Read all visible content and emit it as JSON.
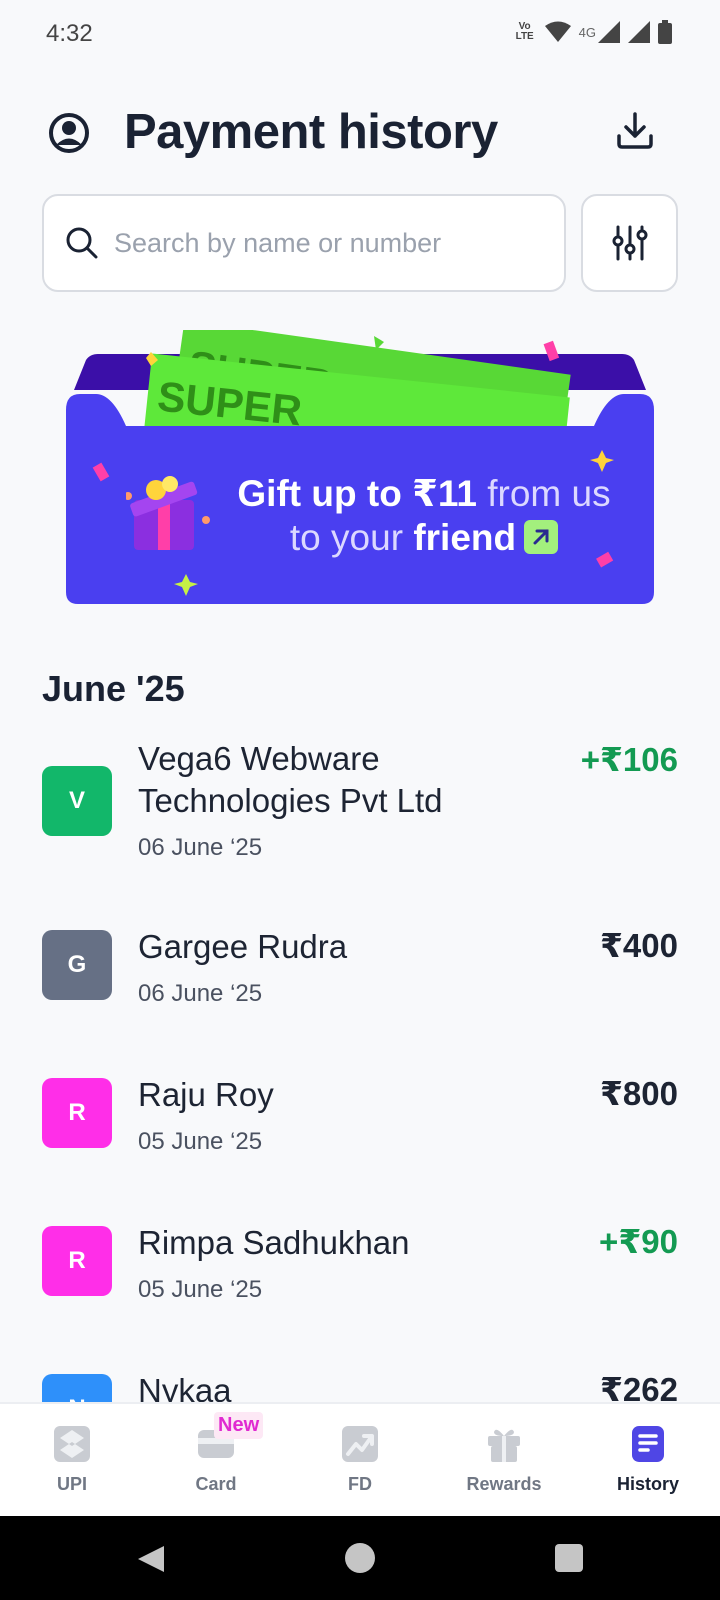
{
  "status_bar": {
    "time": "4:32",
    "volte_line1": "Vo",
    "volte_line2": "LTE",
    "network": "4G"
  },
  "header": {
    "title": "Payment history",
    "profile_icon": "profile-icon",
    "download_icon": "download-icon"
  },
  "search": {
    "placeholder": "Search by name or number",
    "value": ""
  },
  "promo": {
    "line1_bold": "Gift up to ₹11",
    "line1_light": " from us",
    "line2_light": "to your ",
    "line2_bold": "friend",
    "ticket_text": "SUPER"
  },
  "section": {
    "month": "June '25"
  },
  "transactions": [
    {
      "initial": "V",
      "name": "Vega6 Webware Technologies Pvt Ltd",
      "date": "06 June ‘25",
      "amount": "+₹106",
      "type": "credit",
      "avatar_color": "#12b76a"
    },
    {
      "initial": "G",
      "name": "Gargee  Rudra",
      "date": "06 June ‘25",
      "amount": "₹400",
      "type": "debit",
      "avatar_color": "#667085"
    },
    {
      "initial": "R",
      "name": "Raju Roy",
      "date": "05 June ‘25",
      "amount": "₹800",
      "type": "debit",
      "avatar_color": "#ff2ee8"
    },
    {
      "initial": "R",
      "name": "Rimpa  Sadhukhan",
      "date": "05 June ‘25",
      "amount": "+₹90",
      "type": "credit",
      "avatar_color": "#ff2ee8"
    },
    {
      "initial": "N",
      "name": "Nykaa",
      "date": "",
      "amount": "₹262",
      "type": "debit",
      "avatar_color": "#2e90fa"
    }
  ],
  "bottom_nav": {
    "items": [
      {
        "label": "UPI",
        "icon": "upi-icon"
      },
      {
        "label": "Card",
        "icon": "card-icon",
        "badge": "New"
      },
      {
        "label": "FD",
        "icon": "fd-chart-icon"
      },
      {
        "label": "Rewards",
        "icon": "gift-icon"
      },
      {
        "label": "History",
        "icon": "history-icon",
        "active": true
      }
    ]
  },
  "colors": {
    "accent": "#4f46e5",
    "credit": "#139a52",
    "banner": "#4f46e5",
    "banner_dark": "#3b0fa8"
  }
}
